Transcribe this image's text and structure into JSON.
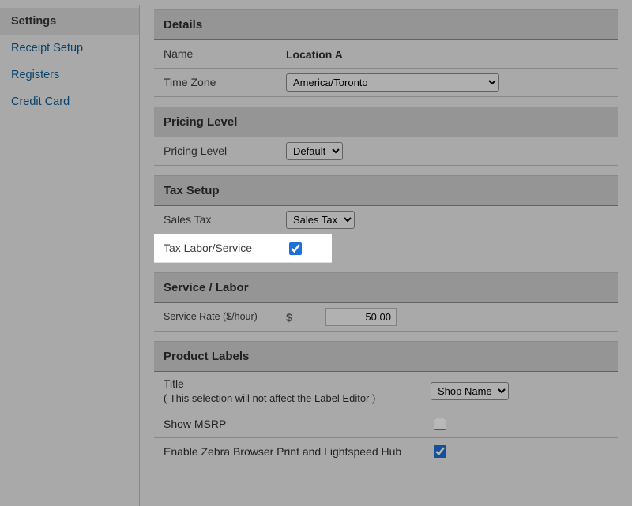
{
  "sidebar": {
    "heading": "Settings",
    "items": [
      {
        "label": "Receipt Setup"
      },
      {
        "label": "Registers"
      },
      {
        "label": "Credit Card"
      }
    ]
  },
  "details": {
    "header": "Details",
    "name_label": "Name",
    "name_value": "Location A",
    "tz_label": "Time Zone",
    "tz_value": "America/Toronto"
  },
  "pricing": {
    "header": "Pricing Level",
    "label": "Pricing Level",
    "value": "Default"
  },
  "tax": {
    "header": "Tax Setup",
    "sales_tax_label": "Sales Tax",
    "sales_tax_value": "Sales Tax",
    "labor_label": "Tax Labor/Service",
    "labor_checked": true
  },
  "service": {
    "header": "Service / Labor",
    "rate_label": "Service Rate ($/hour)",
    "rate_prefix": "$",
    "rate_value": "50.00"
  },
  "labels": {
    "header": "Product Labels",
    "title_label_line1": "Title",
    "title_label_line2": "( This selection will not affect the Label Editor )",
    "title_value": "Shop Name",
    "msrp_label": "Show MSRP",
    "msrp_checked": false,
    "zebra_label": "Enable Zebra Browser Print and Lightspeed Hub",
    "zebra_checked": true
  }
}
